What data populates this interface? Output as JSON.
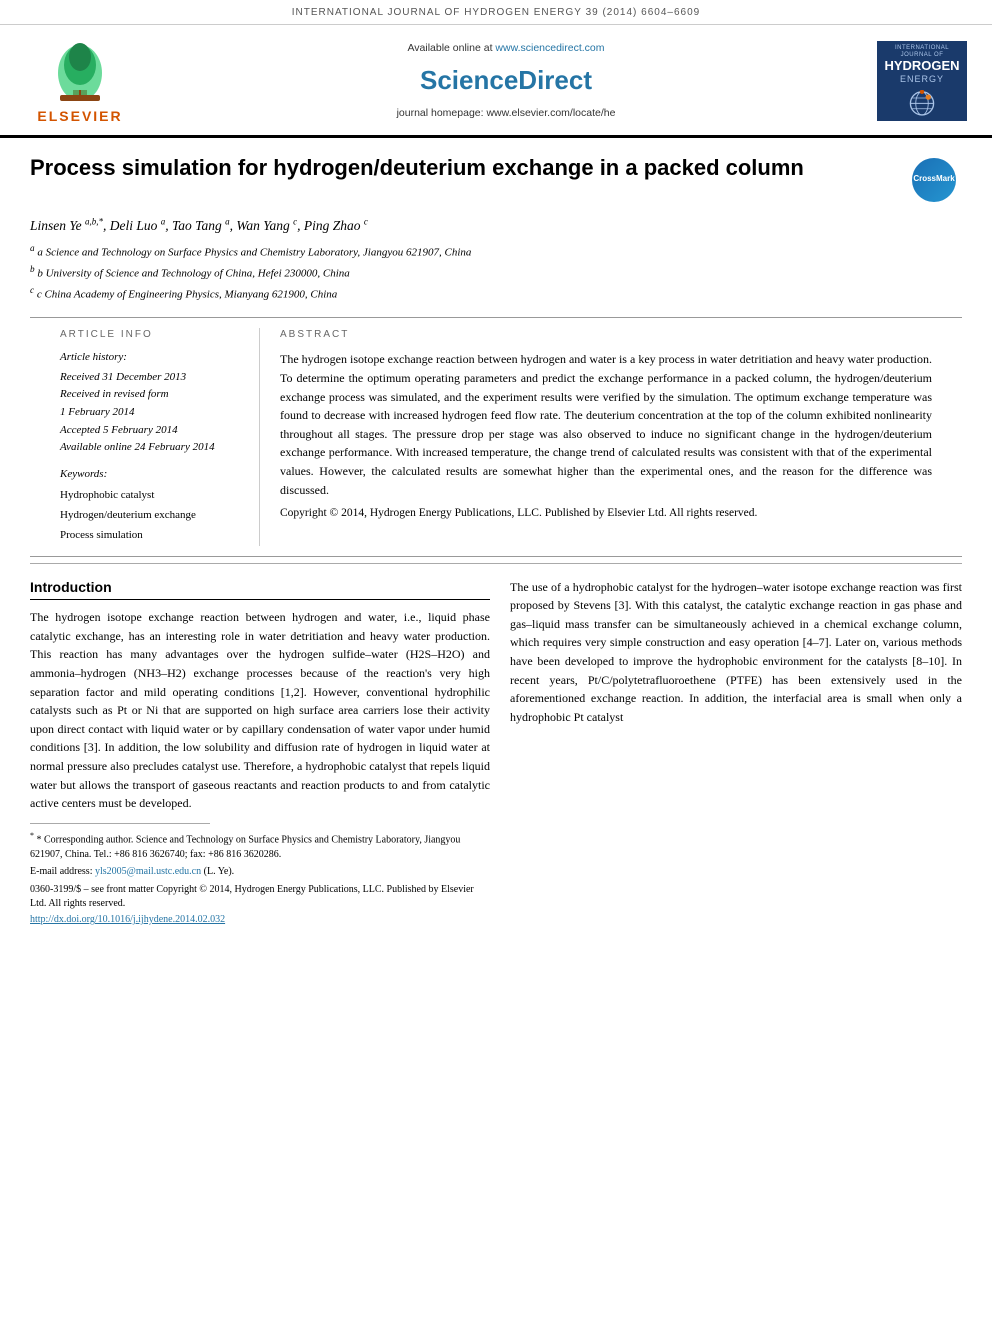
{
  "topbar": {
    "text": "INTERNATIONAL JOURNAL OF HYDROGEN ENERGY 39 (2014) 6604–6609"
  },
  "header": {
    "available_online": "Available online at www.sciencedirect.com",
    "sciencedirect_url": "www.sciencedirect.com",
    "sciencedirect_title": "ScienceDirect",
    "journal_homepage": "journal homepage: www.elsevier.com/locate/he",
    "elsevier_label": "ELSEVIER",
    "journal_logo_intl": "INTERNATIONAL JOURNAL OF",
    "journal_logo_hydrogen": "HYDROGEN",
    "journal_logo_energy": "ENERGY"
  },
  "article": {
    "title": "Process simulation for hydrogen/deuterium exchange in a packed column",
    "crossmark_label": "CrossMark"
  },
  "authors": {
    "list": "Linsen Ye a,b,*, Deli Luo a, Tao Tang a, Wan Yang c, Ping Zhao c",
    "affiliations": [
      "a Science and Technology on Surface Physics and Chemistry Laboratory, Jiangyou 621907, China",
      "b University of Science and Technology of China, Hefei 230000, China",
      "c China Academy of Engineering Physics, Mianyang 621900, China"
    ]
  },
  "article_info": {
    "header": "ARTICLE INFO",
    "history_title": "Article history:",
    "received": "Received 31 December 2013",
    "received_revised": "Received in revised form",
    "revised_date": "1 February 2014",
    "accepted": "Accepted 5 February 2014",
    "available": "Available online 24 February 2014",
    "keywords_title": "Keywords:",
    "keywords": [
      "Hydrophobic catalyst",
      "Hydrogen/deuterium exchange",
      "Process simulation"
    ]
  },
  "abstract": {
    "header": "ABSTRACT",
    "text": "The hydrogen isotope exchange reaction between hydrogen and water is a key process in water detritiation and heavy water production. To determine the optimum operating parameters and predict the exchange performance in a packed column, the hydrogen/deuterium exchange process was simulated, and the experiment results were verified by the simulation. The optimum exchange temperature was found to decrease with increased hydrogen feed flow rate. The deuterium concentration at the top of the column exhibited nonlinearity throughout all stages. The pressure drop per stage was also observed to induce no significant change in the hydrogen/deuterium exchange performance. With increased temperature, the change trend of calculated results was consistent with that of the experimental values. However, the calculated results are somewhat higher than the experimental ones, and the reason for the difference was discussed.",
    "copyright": "Copyright © 2014, Hydrogen Energy Publications, LLC. Published by Elsevier Ltd. All rights reserved."
  },
  "introduction": {
    "title": "Introduction",
    "paragraph1": "The hydrogen isotope exchange reaction between hydrogen and water, i.e., liquid phase catalytic exchange, has an interesting role in water detritiation and heavy water production. This reaction has many advantages over the hydrogen sulfide–water (H2S–H2O) and ammonia–hydrogen (NH3–H2) exchange processes because of the reaction's very high separation factor and mild operating conditions [1,2]. However, conventional hydrophilic catalysts such as Pt or Ni that are supported on high surface area carriers lose their activity upon direct contact with liquid water or by capillary condensation of water vapor under humid conditions [3]. In addition, the low solubility and diffusion rate of hydrogen in liquid water at normal pressure also precludes catalyst use. Therefore, a hydrophobic catalyst that repels liquid water but allows the transport of gaseous reactants and reaction products to and from catalytic active centers must be developed.",
    "paragraph2": "The use of a hydrophobic catalyst for the hydrogen–water isotope exchange reaction was first proposed by Stevens [3]. With this catalyst, the catalytic exchange reaction in gas phase and gas–liquid mass transfer can be simultaneously achieved in a chemical exchange column, which requires very simple construction and easy operation [4–7]. Later on, various methods have been developed to improve the hydrophobic environment for the catalysts [8–10]. In recent years, Pt/C/polytetrafluoroethene (PTFE) has been extensively used in the aforementioned exchange reaction. In addition, the interfacial area is small when only a hydrophobic Pt catalyst"
  },
  "footnotes": {
    "corresponding": "* Corresponding author. Science and Technology on Surface Physics and Chemistry Laboratory, Jiangyou 621907, China. Tel.: +86 816 3626740; fax: +86 816 3620286.",
    "email_label": "E-mail address:",
    "email": "yls2005@mail.ustc.edu.cn",
    "email_suffix": " (L. Ye).",
    "issn": "0360-3199/$ – see front matter Copyright © 2014, Hydrogen Energy Publications, LLC. Published by Elsevier Ltd. All rights reserved.",
    "doi_text": "http://dx.doi.org/10.1016/j.ijhydene.2014.02.032"
  }
}
